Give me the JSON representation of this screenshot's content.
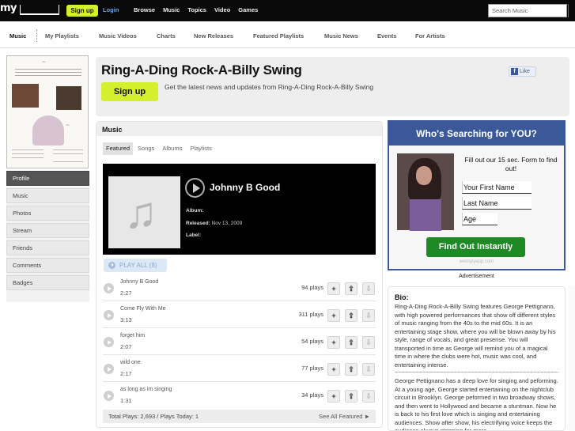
{
  "topbar": {
    "logo": "my",
    "signup": "Sign up",
    "login": "Login",
    "nav": [
      "Browse",
      "Music",
      "Topics",
      "Video",
      "Games"
    ],
    "search_placeholder": "Search Music"
  },
  "subnav": {
    "items": [
      "Music",
      "My Playlists",
      "Music Videos",
      "Charts",
      "New Releases",
      "Featured Playlists",
      "Music News",
      "Events",
      "For Artists"
    ]
  },
  "leftnav": {
    "items": [
      "Profile",
      "Music",
      "Photos",
      "Stream",
      "Friends",
      "Comments",
      "Badges"
    ]
  },
  "header": {
    "title": "Ring-A-Ding Rock-A-Billy Swing",
    "signup": "Sign up",
    "description": "Get the latest news and updates from Ring-A-Ding Rock-A-Billy Swing",
    "like": "Like"
  },
  "music": {
    "title": "Music",
    "tabs": [
      "Featured",
      "Songs",
      "Albums",
      "Playlists"
    ],
    "featured": {
      "label": "",
      "song": "Johnny B Good",
      "album_label": "Album:",
      "album": "",
      "released_label": "Released:",
      "released": "Nov 13, 2009",
      "label_label": "Label:"
    },
    "play_all": "PLAY ALL (8)",
    "tracks": [
      {
        "name": "Johnny B Good",
        "duration": "2:27",
        "plays": "94 plays"
      },
      {
        "name": "Come Fly With Me",
        "duration": "3:13",
        "plays": "311 plays"
      },
      {
        "name": "forget him",
        "duration": "2:07",
        "plays": "54 plays"
      },
      {
        "name": "wild one",
        "duration": "2:17",
        "plays": "77 plays"
      },
      {
        "name": "as long as im singing",
        "duration": "1:31",
        "plays": "34 plays"
      }
    ],
    "totals": "Total Plays: 2,693 / Plays Today: 1",
    "see_all": "See All Featured ►"
  },
  "ad": {
    "headline": "Who's Searching for YOU?",
    "text": "Fill out our 15 sec. Form to find out!",
    "fields": [
      "Your First Name",
      "Last Name",
      "Age"
    ],
    "button": "Find Out Instantly",
    "domain": "webspyapp.com",
    "label": "Advertisement"
  },
  "bio": {
    "title": "Bio:",
    "p1": "Ring-A-Ding Rock-A-Billy Swing features George Pettignano, with high powered performances that show off different styles of music ranging from the 40s to the mid 60s. It is an entertaining stage show, where you will be blown away by his style, range of vocals, and great presense. You will transported in time as George will remind you of a magical time in where the clubs were hot, music was cool, and entertaining intense.",
    "separator": "~~~~~~~~~~~~~~~~~~~~~~~~~~~~~~~~~~~~~~~~~~~~~~~~~~~~~~~~~~~~~~~~~~~~~~~~~~~~~~~~~",
    "p2": "George Pettignano has a deep love for singing and peforming. At a young age, George started entertaining on the nightclub circuit in Brooklyn. George peformed in two broadway shows, and then went to Hollywood and became a stuntman. Now he is back to his first love which is singing and entertaining audiences. Show after show, his electrifying voice keeps the audience always storming for more."
  }
}
